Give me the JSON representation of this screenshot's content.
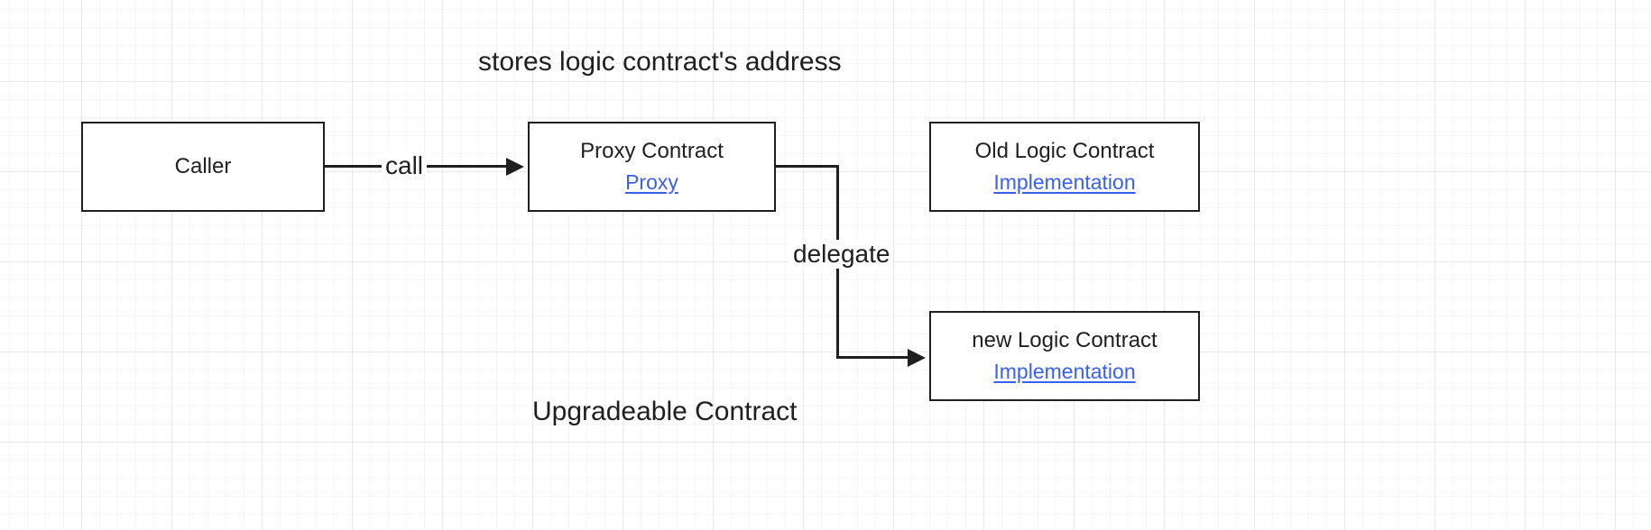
{
  "title_top": "stores logic contract's address",
  "title_bottom": "Upgradeable Contract",
  "nodes": {
    "caller": {
      "name": "Caller"
    },
    "proxy": {
      "name": "Proxy Contract",
      "role": "Proxy"
    },
    "oldlogic": {
      "name": "Old Logic Contract",
      "role": "Implementation"
    },
    "newlogic": {
      "name": "new Logic Contract",
      "role": "Implementation"
    }
  },
  "edges": {
    "call": {
      "label": "call"
    },
    "delegate": {
      "label": "delegate"
    }
  }
}
